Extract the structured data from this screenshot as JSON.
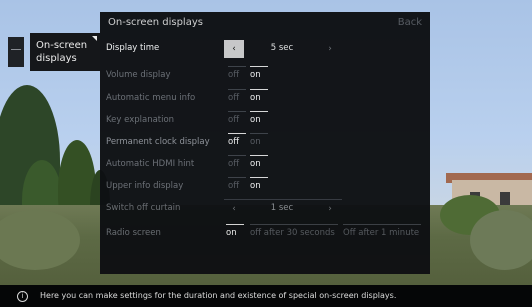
{
  "panel": {
    "title": "On-screen displays",
    "back_label": "Back"
  },
  "breadcrumb": {
    "label": "On-screen displays"
  },
  "rows": [
    {
      "label": "Display time",
      "type": "stepper",
      "value": "5 sec"
    },
    {
      "label": "Volume display",
      "type": "toggle",
      "off": "off",
      "on": "on",
      "selected": "on"
    },
    {
      "label": "Automatic menu info",
      "type": "toggle",
      "off": "off",
      "on": "on",
      "selected": "on"
    },
    {
      "label": "Key explanation",
      "type": "toggle",
      "off": "off",
      "on": "on",
      "selected": "on"
    },
    {
      "label": "Permanent clock display",
      "type": "toggle",
      "off": "off",
      "on": "on",
      "selected": "off"
    },
    {
      "label": "Automatic HDMI hint",
      "type": "toggle",
      "off": "off",
      "on": "on",
      "selected": "on"
    },
    {
      "label": "Upper info display",
      "type": "toggle",
      "off": "off",
      "on": "on",
      "selected": "on"
    },
    {
      "label": "Switch off curtain",
      "type": "stepper",
      "value": "1 sec"
    },
    {
      "label": "Radio screen",
      "type": "options",
      "options": [
        "on",
        "off after 30 seconds",
        "Off after 1 minute"
      ],
      "selected": "on"
    }
  ],
  "info": {
    "text": "Here you can make settings for the duration and existence of special on-screen displays.",
    "icon": "info-icon"
  },
  "colors": {
    "panel_bg": "#0e1013",
    "highlight": "#c8c8c8",
    "text_active": "#f2f2f2",
    "text_inactive": "#6a6e74"
  }
}
